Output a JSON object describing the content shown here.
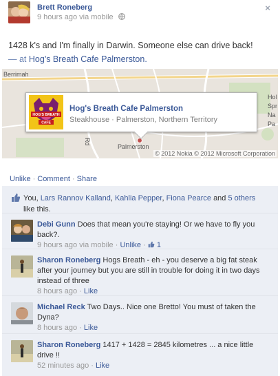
{
  "post": {
    "author": "Brett Roneberg",
    "time": "9 hours ago via mobile",
    "close": "×",
    "status_text": "1428 k's and I'm finally in Darwin. Someone else can drive back!",
    "with_prefix": "— at",
    "place_link": "Hog's Breath Cafe Palmerston."
  },
  "map": {
    "labels": {
      "berrimah": "Berrimah",
      "palmerston": "Palmerston",
      "rd": "Rd",
      "hol": "Hol",
      "spr": "Spr",
      "na": "Na",
      "pa": "Pa"
    },
    "copyright": "© 2012 Nokia © 2012 Microsoft Corporation",
    "place": {
      "name": "Hog's Breath Cafe Palmerston",
      "subtitle": "Steakhouse · Palmerston, Northern Territory",
      "logo_text_top": "HOG'S BREATH",
      "logo_text_bottom": "CAFE"
    }
  },
  "actions": {
    "unlike": "Unlike",
    "comment": "Comment",
    "share": "Share",
    "separator": "·"
  },
  "likes": {
    "prefix": "You,",
    "names": [
      "Lars Rannov Kalland",
      "Kahlia Pepper",
      "Fiona Pearce"
    ],
    "sep1": ",",
    "and": "and",
    "others": "5 others",
    "suffix": "like this."
  },
  "comments": [
    {
      "author": "Debi Gunn",
      "text": "Does that mean you're staying! Or we have to fly you back?.",
      "time": "9 hours ago via mobile",
      "action": "Unlike",
      "like_count": "1"
    },
    {
      "author": "Sharon Roneberg",
      "text": "Hogs Breath - eh - you deserve a big fat steak after your journey but you are still in trouble for doing it in two days instead of three",
      "time": "8 hours ago",
      "action": "Like"
    },
    {
      "author": "Michael Reck",
      "text": "Two Days.. Nice one Bretto! You must of taken the Dyna?",
      "time": "8 hours ago",
      "action": "Like"
    },
    {
      "author": "Sharon Roneberg",
      "text": "1417 + 1428 = 2845 kilometres ... a nice little drive !!",
      "time": "52 minutes ago",
      "action": "Like"
    }
  ]
}
